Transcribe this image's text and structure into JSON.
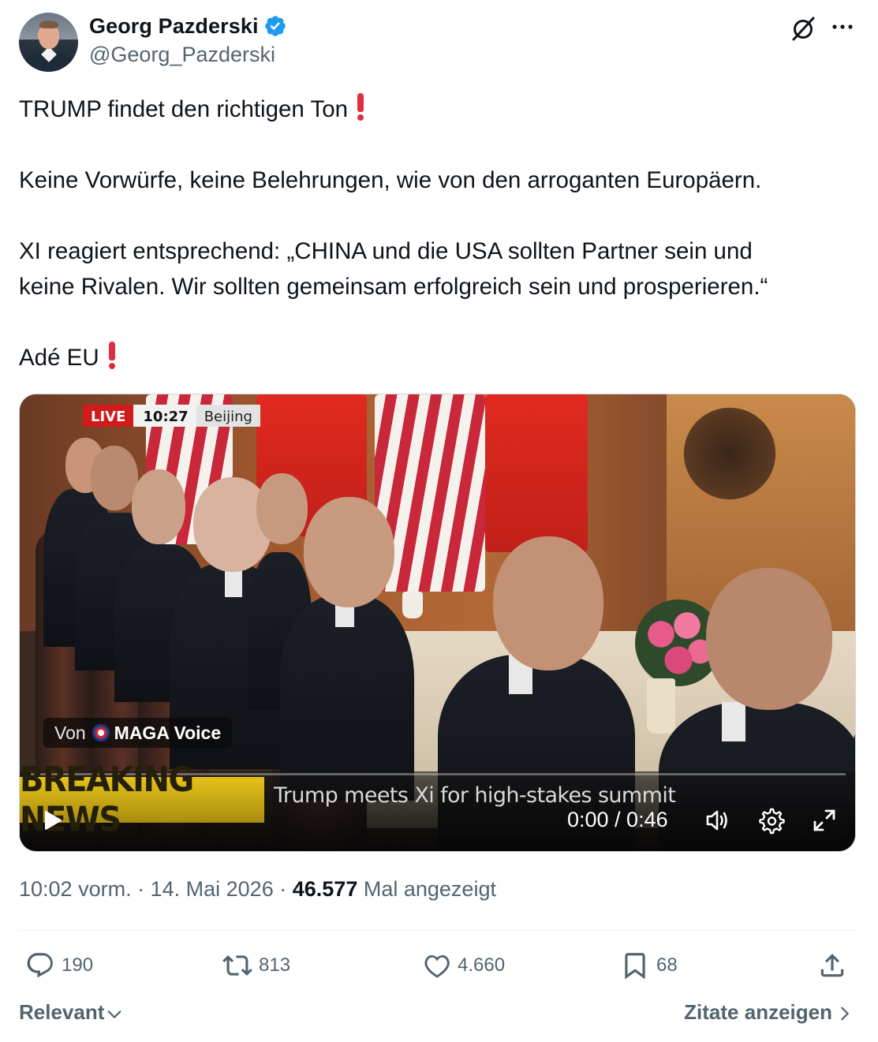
{
  "author": {
    "display_name": "Georg Pazderski",
    "handle": "@Georg_Pazderski",
    "verified": true,
    "verified_color": "#1d9bf0"
  },
  "header_icons": [
    "grok-icon",
    "more-icon"
  ],
  "tweet": {
    "lines": [
      "TRUMP findet den richtigen Ton",
      "Keine Vorwürfe, keine Belehrungen, wie von den arroganten Europäern.",
      "XI reagiert entsprechend: „CHINA und die USA sollten Partner sein und",
      "keine Rivalen. Wir sollten gemeinsam erfolgreich sein und prosperieren.“",
      "Adé EU"
    ]
  },
  "video": {
    "live_label": "LIVE",
    "live_time": "10:27",
    "live_place": "Beijing",
    "source_prefix": "Von",
    "source_name": "MAGA Voice",
    "breaking_label": "BREAKING NEWS",
    "headline": "Trump meets Xi for high-stakes summit",
    "time_display": "0:00 / 0:46",
    "progress": 0
  },
  "meta": {
    "time": "10:02 vorm.",
    "sep1": "·",
    "date": "14. Mai 2026",
    "sep2": "·",
    "views": "46.577",
    "views_label": "Mal angezeigt"
  },
  "actions": {
    "replies": "190",
    "reposts": "813",
    "likes": "4.660",
    "bookmarks": "68"
  },
  "footer": {
    "sort_label": "Relevant",
    "quotes_label": "Zitate anzeigen"
  },
  "colors": {
    "text": "#0f1419",
    "secondary": "#536471",
    "accent": "#1d9bf0",
    "alert_red": "#dd2e44"
  }
}
